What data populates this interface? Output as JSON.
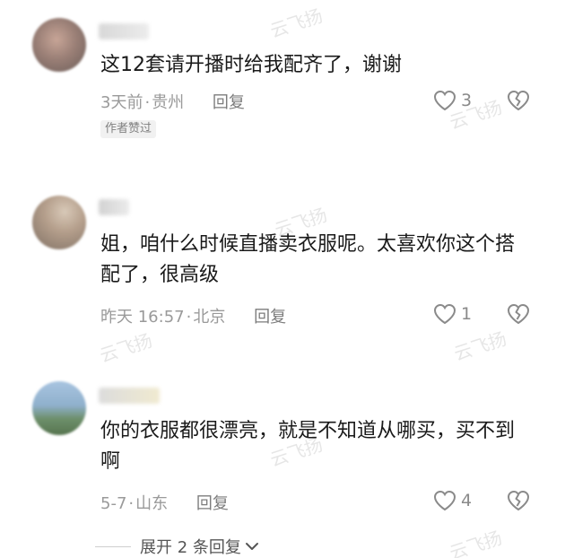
{
  "comments": [
    {
      "text": "这12套请开播时给我配齐了，谢谢",
      "time": "3天前",
      "location": "贵州",
      "reply_label": "回复",
      "likes": "3",
      "badge": "作者赞过"
    },
    {
      "text": "姐，咱什么时候直播卖衣服呢。太喜欢你这个搭配了，很高级",
      "time": "昨天 16:57",
      "location": "北京",
      "reply_label": "回复",
      "likes": "1"
    },
    {
      "text": "你的衣服都很漂亮，就是不知道从哪买，买不到啊",
      "time": "5-7",
      "location": "山东",
      "reply_label": "回复",
      "likes": "4"
    }
  ],
  "meta_separator": "·",
  "expand": {
    "label": "展开 2 条回复"
  },
  "watermark": "云飞扬",
  "icons": {
    "like": "heart-outline-icon",
    "dislike": "broken-heart-icon",
    "expand": "chevron-down-icon"
  },
  "colors": {
    "text": "#1a1a1a",
    "meta": "#9a9a9a",
    "badge_bg": "#f1f1f1"
  }
}
